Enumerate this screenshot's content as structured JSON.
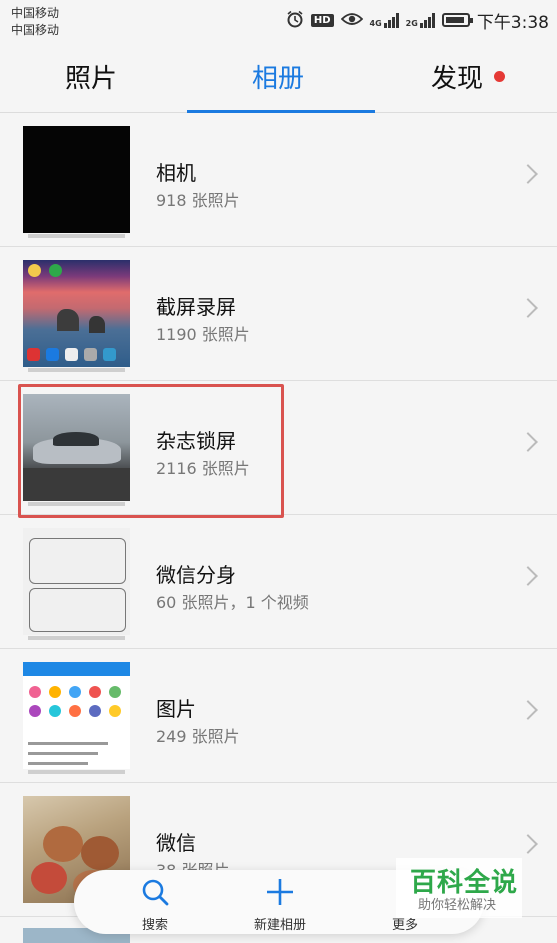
{
  "status_bar": {
    "carrier_1": "中国移动",
    "carrier_2": "中国移动",
    "hd": "HD",
    "net_1": "4G",
    "net_2": "2G",
    "time": "下午3:38",
    "icons": [
      "alarm-icon",
      "eye-icon",
      "signal-icon",
      "battery-icon"
    ]
  },
  "tabs": {
    "photos": "照片",
    "albums": "相册",
    "discover": "发现",
    "active": "albums",
    "accent_color": "#1b7ae0",
    "badge_color": "#e53935"
  },
  "albums": [
    {
      "name": "相机",
      "count": "918 张照片"
    },
    {
      "name": "截屏录屏",
      "count": "1190 张照片"
    },
    {
      "name": "杂志锁屏",
      "count": "2116 张照片"
    },
    {
      "name": "微信分身",
      "count": "60 张照片，1 个视频"
    },
    {
      "name": "图片",
      "count": "249 张照片"
    },
    {
      "name": "微信",
      "count": "38 张照片"
    }
  ],
  "bottom_bar": {
    "search": "搜索",
    "new_album": "新建相册",
    "more": "更多"
  },
  "watermark": {
    "title": "百科全说",
    "subtitle": "助你轻松解决"
  }
}
